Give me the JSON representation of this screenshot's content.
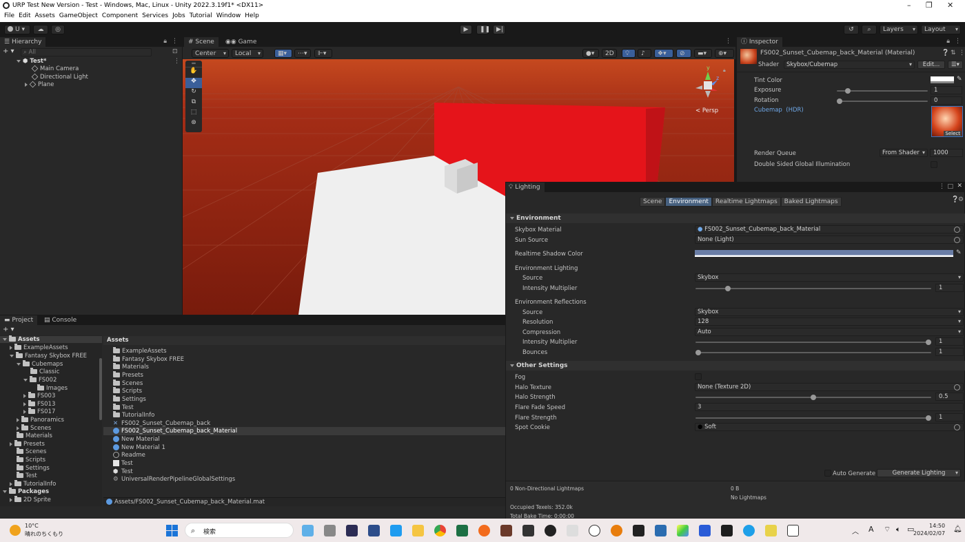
{
  "window": {
    "title": "URP Test New Version - Test - Windows, Mac, Linux - Unity 2022.3.19f1* <DX11>",
    "minimize": "–",
    "maximize": "❐",
    "close": "✕"
  },
  "menu": [
    "File",
    "Edit",
    "Assets",
    "GameObject",
    "Component",
    "Services",
    "Jobs",
    "Tutorial",
    "Window",
    "Help"
  ],
  "toolbar": {
    "account": "U ▾",
    "layers": "Layers",
    "layout": "Layout"
  },
  "hierarchy": {
    "tab": "Hierarchy",
    "search_placeholder": "All",
    "scene": "Test*",
    "items": [
      "Main Camera",
      "Directional Light",
      "Plane"
    ]
  },
  "scene_view": {
    "tab_scene": "Scene",
    "tab_game": "Game",
    "pivot": "Center",
    "space": "Local",
    "mode_2d": "2D",
    "persp": "< Persp",
    "gizmo_y": "y",
    "gizmo_z": "z"
  },
  "inspector": {
    "tab": "Inspector",
    "material": "FS002_Sunset_Cubemap_back_Material (Material)",
    "shader_label": "Shader",
    "shader": "Skybox/Cubemap",
    "edit": "Edit...",
    "tint": "Tint Color",
    "exposure": "Exposure",
    "exposure_val": "1",
    "rotation": "Rotation",
    "rotation_val": "0",
    "cubemap": "Cubemap",
    "hdr": "(HDR)",
    "select": "Select",
    "render_queue": "Render Queue",
    "rq_mode": "From Shader",
    "rq_val": "1000",
    "dsgi": "Double Sided Global Illumination"
  },
  "lighting": {
    "title": "Lighting",
    "tabs": [
      "Scene",
      "Environment",
      "Realtime Lightmaps",
      "Baked Lightmaps"
    ],
    "env_header": "Environment",
    "skybox_material": "Skybox Material",
    "skybox_material_val": "FS002_Sunset_Cubemap_back_Material",
    "sun_source": "Sun Source",
    "sun_source_val": "None (Light)",
    "shadow_color": "Realtime Shadow Color",
    "env_lighting": "Environment Lighting",
    "el_source": "Source",
    "el_source_val": "Skybox",
    "el_intensity": "Intensity Multiplier",
    "el_intensity_val": "1",
    "env_reflections": "Environment Reflections",
    "er_source": "Source",
    "er_source_val": "Skybox",
    "resolution": "Resolution",
    "resolution_val": "128",
    "compression": "Compression",
    "compression_val": "Auto",
    "er_intensity": "Intensity Multiplier",
    "er_intensity_val": "1",
    "bounces": "Bounces",
    "bounces_val": "1",
    "other_header": "Other Settings",
    "fog": "Fog",
    "halo_texture": "Halo Texture",
    "halo_texture_val": "None (Texture 2D)",
    "halo_strength": "Halo Strength",
    "halo_strength_val": "0.5",
    "flare_fade": "Flare Fade Speed",
    "flare_fade_val": "3",
    "flare_strength": "Flare Strength",
    "flare_strength_val": "1",
    "spot_cookie": "Spot Cookie",
    "spot_cookie_val": "Soft",
    "auto_generate": "Auto Generate",
    "generate": "Generate Lighting",
    "stats": {
      "non_dir": "0 Non-Directional Lightmaps",
      "size": "0 B",
      "no_lightmaps": "No Lightmaps",
      "texels": "Occupied Texels: 352.0k",
      "bake_time": "Total Bake Time: 0:00:00"
    }
  },
  "sliders": {
    "exposure": 0.1,
    "rotation": 0.0,
    "el_intensity": 0.13,
    "er_intensity": 1.0,
    "bounces": 0.0,
    "halo_strength": 0.5,
    "flare_strength": 1.0
  },
  "project": {
    "tab_project": "Project",
    "tab_console": "Console",
    "tree": [
      "Assets",
      "ExampleAssets",
      "Fantasy Skybox FREE",
      "Cubemaps",
      "Classic",
      "FS002",
      "Images",
      "FS003",
      "FS013",
      "FS017",
      "Panoramics",
      "Scenes",
      "Materials",
      "Presets",
      "Scenes",
      "Scripts",
      "Settings",
      "Test",
      "TutorialInfo",
      "Packages",
      "2D Sprite"
    ],
    "breadcrumb": "Assets",
    "items": [
      "ExampleAssets",
      "Fantasy Skybox FREE",
      "Materials",
      "Presets",
      "Scenes",
      "Scripts",
      "Settings",
      "Test",
      "TutorialInfo",
      "FS002_Sunset_Cubemap_back",
      "FS002_Sunset_Cubemap_back_Material",
      "New Material",
      "New Material 1",
      "Readme",
      "Test",
      "Test",
      "UniversalRenderPipelineGlobalSettings"
    ],
    "path": "Assets/FS002_Sunset_Cubemap_back_Material.mat"
  },
  "taskbar": {
    "temp": "10°C",
    "weather": "晴れのちくもり",
    "search": "検索",
    "time": "14:50",
    "date": "2024/02/07",
    "ime": "A"
  }
}
